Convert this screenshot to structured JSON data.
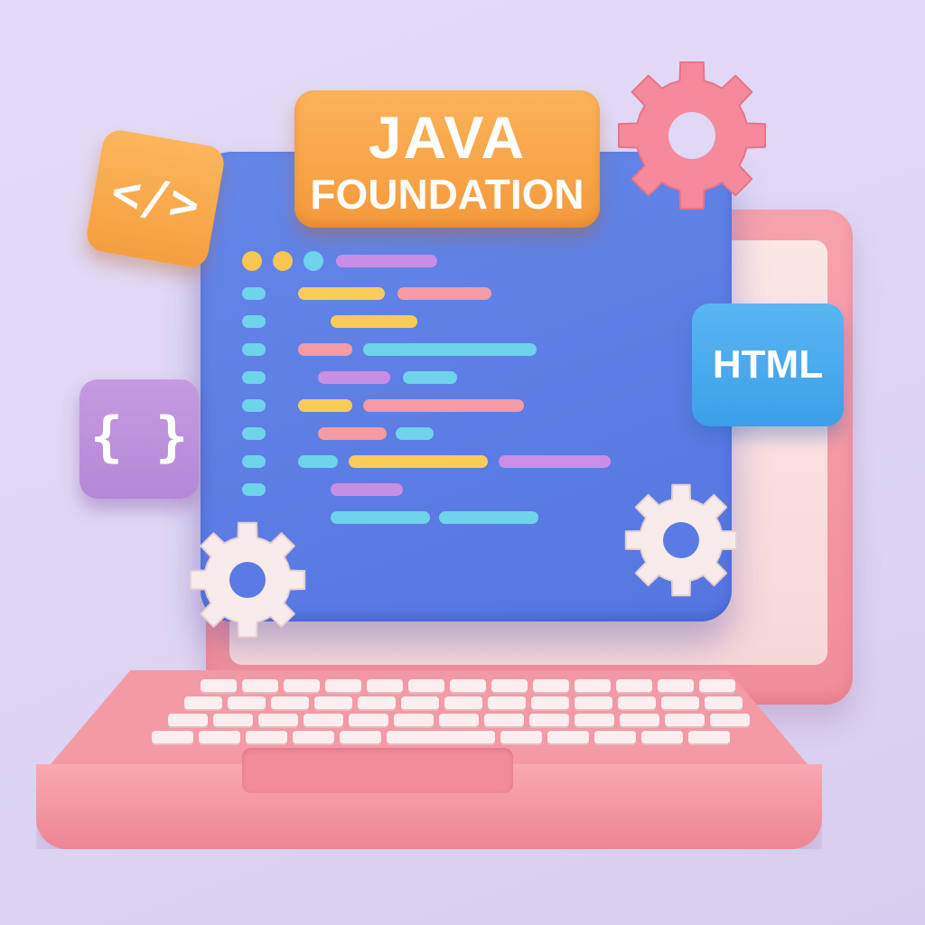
{
  "badges": {
    "java_line1": "JAVA",
    "java_line2": "FOUNDATION",
    "code_tag": "</>",
    "braces": "{ }",
    "html": "HTML"
  },
  "icons": [
    "code-tag-icon",
    "curly-braces-icon",
    "gear-icon",
    "laptop-icon"
  ],
  "colors": {
    "background": "#e0d8f4",
    "laptop": "#f39aa5",
    "code_window": "#5b7be3",
    "java_badge": "#f8a64a",
    "html_badge": "#49aaee",
    "braces_badge": "#be90dc",
    "pink_gear": "#f48a9c",
    "white_gear": "#f8eceb",
    "code_yellow": "#f9cc5a",
    "code_pink": "#f69aa5",
    "code_cyan": "#6fd3ec",
    "code_purple": "#c88ee6"
  }
}
